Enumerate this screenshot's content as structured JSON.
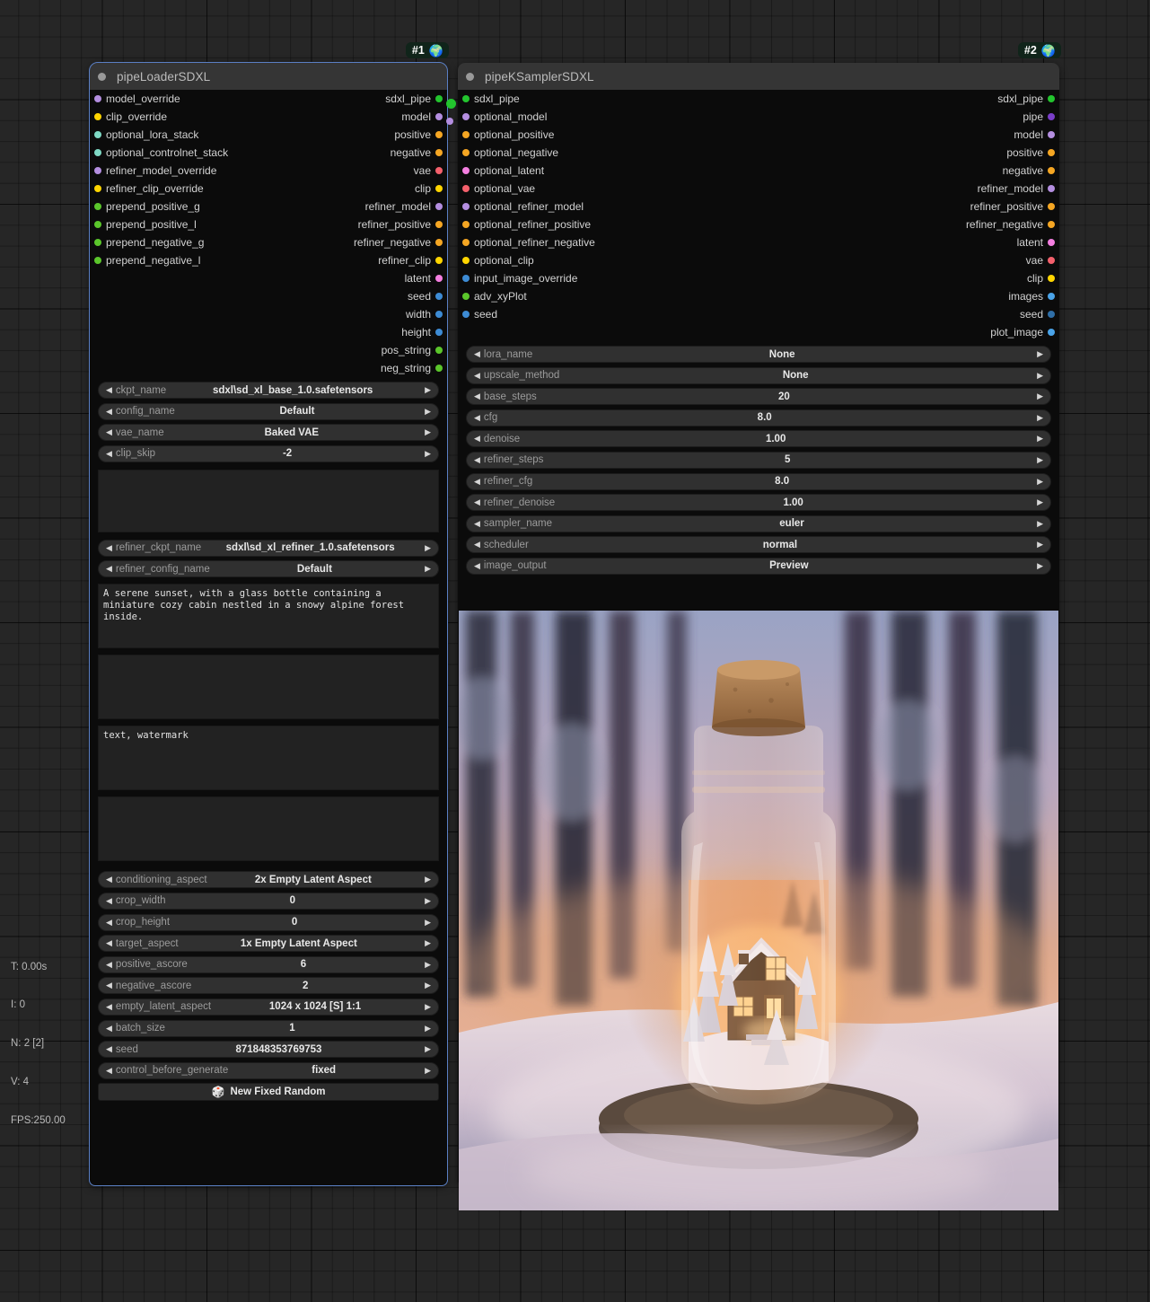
{
  "stats": {
    "time": "T: 0.00s",
    "iterations": "I: 0",
    "nodes": "N: 2 [2]",
    "version": "V: 4",
    "fps": "FPS:250.00"
  },
  "nodes": [
    {
      "badge": "#1",
      "badge_icon": "globe-icon",
      "title": "pipeLoaderSDXL",
      "inputs": [
        {
          "label": "model_override",
          "color": "#b48ee0"
        },
        {
          "label": "clip_override",
          "color": "#ffd500"
        },
        {
          "label": "optional_lora_stack",
          "color": "#7fd9c4"
        },
        {
          "label": "optional_controlnet_stack",
          "color": "#7fd9c4"
        },
        {
          "label": "refiner_model_override",
          "color": "#b48ee0"
        },
        {
          "label": "refiner_clip_override",
          "color": "#ffd500"
        },
        {
          "label": "prepend_positive_g",
          "color": "#5bc62b"
        },
        {
          "label": "prepend_positive_l",
          "color": "#5bc62b"
        },
        {
          "label": "prepend_negative_g",
          "color": "#5bc62b"
        },
        {
          "label": "prepend_negative_l",
          "color": "#5bc62b"
        }
      ],
      "outputs": [
        {
          "label": "sdxl_pipe",
          "color": "#23c42e"
        },
        {
          "label": "model",
          "color": "#b48ee0"
        },
        {
          "label": "positive",
          "color": "#f5a623"
        },
        {
          "label": "negative",
          "color": "#f5a623"
        },
        {
          "label": "vae",
          "color": "#f4606c"
        },
        {
          "label": "clip",
          "color": "#ffd500"
        },
        {
          "label": "refiner_model",
          "color": "#b48ee0"
        },
        {
          "label": "refiner_positive",
          "color": "#f5a623"
        },
        {
          "label": "refiner_negative",
          "color": "#f5a623"
        },
        {
          "label": "refiner_clip",
          "color": "#ffd500"
        },
        {
          "label": "latent",
          "color": "#f47fe0"
        },
        {
          "label": "seed",
          "color": "#3d8bd4"
        },
        {
          "label": "width",
          "color": "#3d8bd4"
        },
        {
          "label": "height",
          "color": "#3d8bd4"
        },
        {
          "label": "pos_string",
          "color": "#5bc62b"
        },
        {
          "label": "neg_string",
          "color": "#5bc62b"
        }
      ],
      "widgets_top": [
        {
          "label": "ckpt_name",
          "value": "sdxl\\sd_xl_base_1.0.safetensors"
        },
        {
          "label": "config_name",
          "value": "Default"
        },
        {
          "label": "vae_name",
          "value": "Baked VAE"
        },
        {
          "label": "clip_skip",
          "value": "-2"
        }
      ],
      "widgets_mid": [
        {
          "label": "refiner_ckpt_name",
          "value": "sdxl\\sd_xl_refiner_1.0.safetensors"
        },
        {
          "label": "refiner_config_name",
          "value": "Default"
        }
      ],
      "textareas": [
        {
          "name": "lora-stack-textarea",
          "value": ""
        },
        {
          "name": "positive-prompt-textarea",
          "value": "A serene sunset, with a glass bottle containing a miniature cozy cabin nestled in a snowy alpine forest inside."
        },
        {
          "name": "positive-style-textarea",
          "value": ""
        },
        {
          "name": "negative-prompt-textarea",
          "value": "text, watermark"
        },
        {
          "name": "negative-style-textarea",
          "value": ""
        }
      ],
      "widgets_bottom": [
        {
          "label": "conditioning_aspect",
          "value": "2x Empty Latent Aspect"
        },
        {
          "label": "crop_width",
          "value": "0"
        },
        {
          "label": "crop_height",
          "value": "0"
        },
        {
          "label": "target_aspect",
          "value": "1x Empty Latent Aspect"
        },
        {
          "label": "positive_ascore",
          "value": "6"
        },
        {
          "label": "negative_ascore",
          "value": "2"
        },
        {
          "label": "empty_latent_aspect",
          "value": "1024 x 1024 [S] 1:1"
        },
        {
          "label": "batch_size",
          "value": "1"
        },
        {
          "label": "seed",
          "value": "871848353769753"
        },
        {
          "label": "control_before_generate",
          "value": "fixed"
        }
      ],
      "button": {
        "icon": "dice-icon",
        "label": "New Fixed Random"
      }
    },
    {
      "badge": "#2",
      "badge_icon": "globe-icon",
      "title": "pipeKSamplerSDXL",
      "inputs": [
        {
          "label": "sdxl_pipe",
          "color": "#23c42e"
        },
        {
          "label": "optional_model",
          "color": "#b48ee0"
        },
        {
          "label": "optional_positive",
          "color": "#f5a623"
        },
        {
          "label": "optional_negative",
          "color": "#f5a623"
        },
        {
          "label": "optional_latent",
          "color": "#f47fe0"
        },
        {
          "label": "optional_vae",
          "color": "#f4606c"
        },
        {
          "label": "optional_refiner_model",
          "color": "#b48ee0"
        },
        {
          "label": "optional_refiner_positive",
          "color": "#f5a623"
        },
        {
          "label": "optional_refiner_negative",
          "color": "#f5a623"
        },
        {
          "label": "optional_clip",
          "color": "#ffd500"
        },
        {
          "label": "input_image_override",
          "color": "#3d8bd4"
        },
        {
          "label": "adv_xyPlot",
          "color": "#5bc62b"
        },
        {
          "label": "seed",
          "color": "#3d8bd4"
        }
      ],
      "outputs": [
        {
          "label": "sdxl_pipe",
          "color": "#23c42e"
        },
        {
          "label": "pipe",
          "color": "#7a3ec9"
        },
        {
          "label": "model",
          "color": "#b48ee0"
        },
        {
          "label": "positive",
          "color": "#f5a623"
        },
        {
          "label": "negative",
          "color": "#f5a623"
        },
        {
          "label": "refiner_model",
          "color": "#b48ee0"
        },
        {
          "label": "refiner_positive",
          "color": "#f5a623"
        },
        {
          "label": "refiner_negative",
          "color": "#f5a623"
        },
        {
          "label": "latent",
          "color": "#f47fe0"
        },
        {
          "label": "vae",
          "color": "#f4606c"
        },
        {
          "label": "clip",
          "color": "#ffd500"
        },
        {
          "label": "images",
          "color": "#4aa3e8"
        },
        {
          "label": "seed",
          "color": "#2f6fa8"
        },
        {
          "label": "plot_image",
          "color": "#4aa3e8"
        }
      ],
      "widgets": [
        {
          "label": "lora_name",
          "value": "None"
        },
        {
          "label": "upscale_method",
          "value": "None"
        },
        {
          "label": "base_steps",
          "value": "20"
        },
        {
          "label": "cfg",
          "value": "8.0"
        },
        {
          "label": "denoise",
          "value": "1.00"
        },
        {
          "label": "refiner_steps",
          "value": "5"
        },
        {
          "label": "refiner_cfg",
          "value": "8.0"
        },
        {
          "label": "refiner_denoise",
          "value": "1.00"
        },
        {
          "label": "sampler_name",
          "value": "euler"
        },
        {
          "label": "scheduler",
          "value": "normal"
        },
        {
          "label": "image_output",
          "value": "Preview"
        }
      ],
      "preview": {
        "name": "generated-image-preview",
        "description": "Miniature snowy cabin inside a corked glass bottle on a wood slice, set in a snowy pine forest at sunset"
      }
    }
  ]
}
